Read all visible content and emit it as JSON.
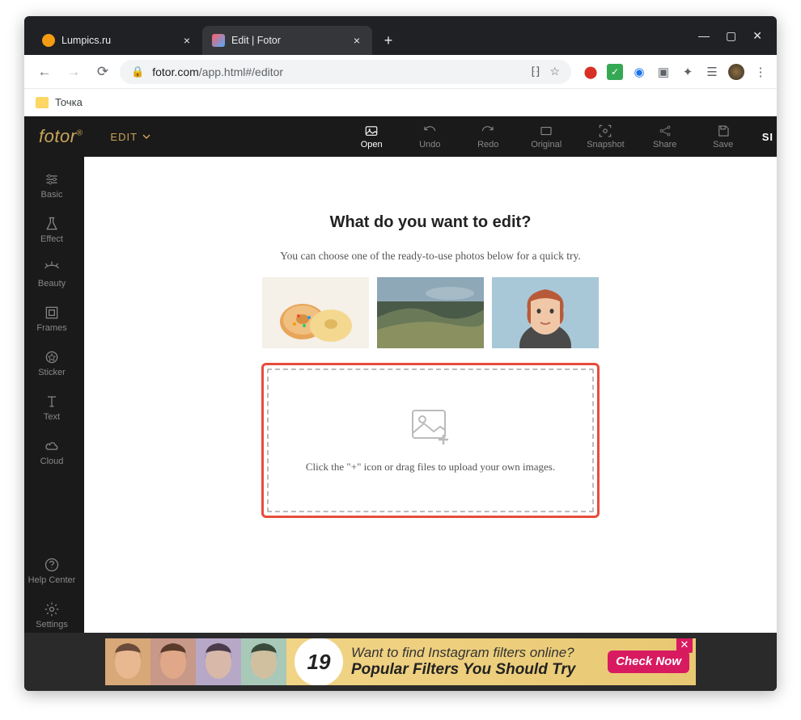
{
  "browser": {
    "tabs": [
      {
        "title": "Lumpics.ru",
        "active": false
      },
      {
        "title": "Edit | Fotor",
        "active": true
      }
    ],
    "url_host": "fotor.com",
    "url_path": "/app.html#/editor",
    "bookmark": "Точка"
  },
  "app": {
    "logo": "fotor",
    "mode": "EDIT",
    "sign": "SI",
    "toolbar": {
      "open": "Open",
      "undo": "Undo",
      "redo": "Redo",
      "original": "Original",
      "snapshot": "Snapshot",
      "share": "Share",
      "save": "Save"
    },
    "rail": {
      "basic": "Basic",
      "effect": "Effect",
      "beauty": "Beauty",
      "frames": "Frames",
      "sticker": "Sticker",
      "text": "Text",
      "cloud": "Cloud",
      "help": "Help Center",
      "settings": "Settings"
    },
    "welcome": {
      "title": "What do you want to edit?",
      "subtitle": "You can choose one of the ready-to-use photos below for a quick try.",
      "drop_msg": "Click the \"+\" icon or drag files to upload your own images."
    }
  },
  "banner": {
    "number": "19",
    "line1": "Want to find Instagram filters online?",
    "line2": "Popular Filters You Should Try",
    "cta": "Check Now"
  }
}
